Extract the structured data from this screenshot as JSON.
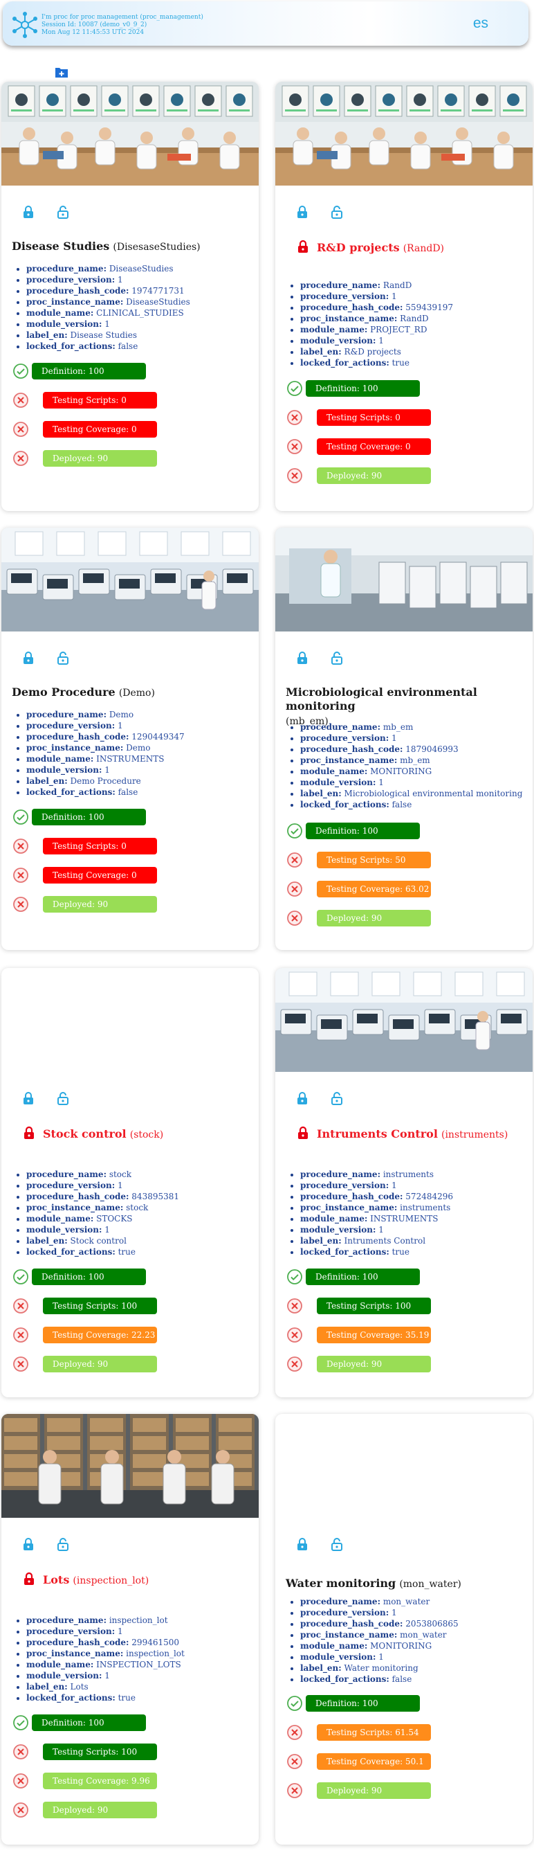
{
  "header": {
    "line1": "I'm proc for proc management (proc_management)",
    "line2": "Session Id: 10087 (demo_v0_9_2)",
    "line3": "Mon Aug 12 11:45:53 UTC 2024",
    "lang": "es"
  },
  "colors": {
    "accent": "#29a8e0",
    "definition_ok": "#008000",
    "bad": "#ff0000",
    "warn": "#ff8c1a",
    "deployed": "#99dd55",
    "locked_title": "#ee1c25",
    "prop_text": "#1d3f8c"
  },
  "labels": {
    "procedure_name": "procedure_name:",
    "procedure_version": "procedure_version:",
    "procedure_hash_code": "procedure_hash_code:",
    "proc_instance_name": "proc_instance_name:",
    "module_name": "module_name:",
    "module_version": "module_version:",
    "label_en": "label_en:",
    "locked_for_actions": "locked_for_actions:"
  },
  "cards": [
    {
      "name": "Disease Studies",
      "code": "(DisesaseStudies)",
      "locked": false,
      "image": "lab-data-analysis",
      "procedure_name": "DiseaseStudies",
      "procedure_version": "1",
      "procedure_hash_code": "1974771731",
      "proc_instance_name": "DiseaseStudies",
      "module_name": "CLINICAL_STUDIES",
      "module_version": "1",
      "label_en": "Disease Studies",
      "locked_for_actions": "false",
      "definition": "Definition: 100",
      "testing_scripts": "Testing Scripts: 0",
      "testing_coverage": "Testing Coverage: 0",
      "deployed": "Deployed: 90"
    },
    {
      "name": "R&D projects",
      "code": "(RandD)",
      "locked": true,
      "image": "lab-data-analysis",
      "procedure_name": "RandD",
      "procedure_version": "1",
      "procedure_hash_code": "559439197",
      "proc_instance_name": "RandD",
      "module_name": "PROJECT_RD",
      "module_version": "1",
      "label_en": "R&D projects",
      "locked_for_actions": "true",
      "definition": "Definition: 100",
      "testing_scripts": "Testing Scripts: 0",
      "testing_coverage": "Testing Coverage: 0",
      "deployed": "Deployed: 90"
    },
    {
      "name": "Demo Procedure",
      "code": "(Demo)",
      "locked": false,
      "image": "lab-instruments",
      "procedure_name": "Demo",
      "procedure_version": "1",
      "procedure_hash_code": "1290449347",
      "proc_instance_name": "Demo",
      "module_name": "INSTRUMENTS",
      "module_version": "1",
      "label_en": "Demo Procedure",
      "locked_for_actions": "false",
      "definition": "Definition: 100",
      "testing_scripts": "Testing Scripts: 0",
      "testing_coverage": "Testing Coverage: 0",
      "deployed": "Deployed: 90"
    },
    {
      "name": "Microbiological environmental monitoring",
      "code": "(mb_em)",
      "locked": false,
      "image": "lab-monitoring",
      "procedure_name": "mb_em",
      "procedure_version": "1",
      "procedure_hash_code": "1879046993",
      "proc_instance_name": "mb_em",
      "module_name": "MONITORING",
      "module_version": "1",
      "label_en": "Microbiological environmental monitoring",
      "locked_for_actions": "false",
      "definition": "Definition: 100",
      "testing_scripts": "Testing Scripts: 50",
      "testing_coverage": "Testing Coverage: 63.02",
      "deployed": "Deployed: 90"
    },
    {
      "name": "Stock control",
      "code": "(stock)",
      "locked": true,
      "image": "",
      "procedure_name": "stock",
      "procedure_version": "1",
      "procedure_hash_code": "843895381",
      "proc_instance_name": "stock",
      "module_name": "STOCKS",
      "module_version": "1",
      "label_en": "Stock control",
      "locked_for_actions": "true",
      "definition": "Definition: 100",
      "testing_scripts": "Testing Scripts: 100",
      "testing_coverage": "Testing Coverage: 22.23",
      "deployed": "Deployed: 90"
    },
    {
      "name": "Intruments Control",
      "code": "(instruments)",
      "locked": true,
      "image": "lab-instruments",
      "procedure_name": "instruments",
      "procedure_version": "1",
      "procedure_hash_code": "572484296",
      "proc_instance_name": "instruments",
      "module_name": "INSTRUMENTS",
      "module_version": "1",
      "label_en": "Intruments Control",
      "locked_for_actions": "true",
      "definition": "Definition: 100",
      "testing_scripts": "Testing Scripts: 100",
      "testing_coverage": "Testing Coverage: 35.19",
      "deployed": "Deployed: 90"
    },
    {
      "name": "Lots",
      "code": "(inspection_lot)",
      "locked": true,
      "image": "warehouse-inspection",
      "procedure_name": "inspection_lot",
      "procedure_version": "1",
      "procedure_hash_code": "299461500",
      "proc_instance_name": "inspection_lot",
      "module_name": "INSPECTION_LOTS",
      "module_version": "1",
      "label_en": "Lots",
      "locked_for_actions": "true",
      "definition": "Definition: 100",
      "testing_scripts": "Testing Scripts: 100",
      "testing_coverage": "Testing Coverage: 9.96",
      "deployed": "Deployed: 90"
    },
    {
      "name": "Water monitoring",
      "code": "(mon_water)",
      "locked": false,
      "image": "",
      "procedure_name": "mon_water",
      "procedure_version": "1",
      "procedure_hash_code": "2053806865",
      "proc_instance_name": "mon_water",
      "module_name": "MONITORING",
      "module_version": "1",
      "label_en": "Water monitoring",
      "locked_for_actions": "false",
      "definition": "Definition: 100",
      "testing_scripts": "Testing Scripts: 61.54",
      "testing_coverage": "Testing Coverage: 50.1",
      "deployed": "Deployed: 90"
    }
  ]
}
